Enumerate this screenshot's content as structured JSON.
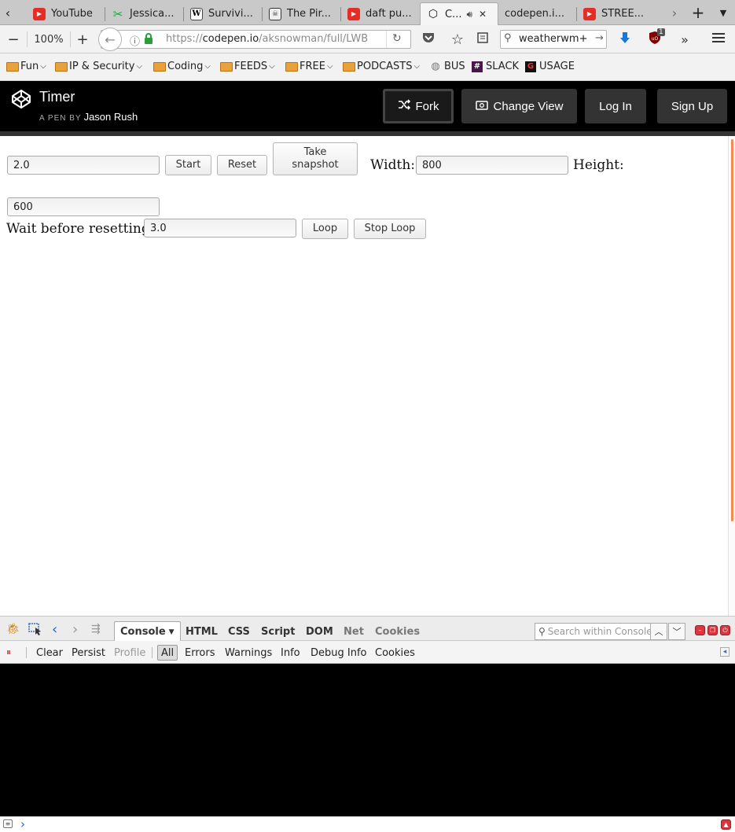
{
  "browser": {
    "tabs": [
      {
        "label": "YouTube",
        "icon": "youtube-icon"
      },
      {
        "label": "Jessica...",
        "icon": "green-logo-icon"
      },
      {
        "label": "Survivi...",
        "icon": "wikipedia-icon"
      },
      {
        "label": "The Pir...",
        "icon": "pirate-icon"
      },
      {
        "label": "daft pu...",
        "icon": "youtube-icon"
      },
      {
        "label": "C...",
        "icon": "codepen-icon",
        "active": true
      },
      {
        "label": "codepen.i...",
        "icon": ""
      },
      {
        "label": "STREE...",
        "icon": "youtube-icon"
      }
    ],
    "zoom": "100%",
    "url_prefix": "https://",
    "url_host": "codepen.io",
    "url_path": "/aksnowman/full/LWB",
    "search_value": "weatherwm+",
    "ublock_badge": "1",
    "bookmarks": [
      {
        "label": "Fun",
        "type": "folder"
      },
      {
        "label": "IP & Security",
        "type": "folder"
      },
      {
        "label": "Coding",
        "type": "folder"
      },
      {
        "label": "FEEDS",
        "type": "folder"
      },
      {
        "label": "FREE",
        "type": "folder"
      },
      {
        "label": "PODCASTS",
        "type": "folder"
      },
      {
        "label": "BUS",
        "type": "link"
      },
      {
        "label": "SLACK",
        "type": "link"
      },
      {
        "label": "USAGE",
        "type": "link"
      }
    ]
  },
  "codepen": {
    "title": "Timer",
    "byline": "A PEN BY",
    "author": "Jason Rush",
    "fork": "Fork",
    "change_view": "Change View",
    "login": "Log In",
    "signup": "Sign Up"
  },
  "app": {
    "duration_value": "2.0",
    "start": "Start",
    "reset": "Reset",
    "snapshot": "Take snapshot",
    "width_label": "Width:",
    "width_value": "800",
    "height_label": "Height:",
    "height_value": "600",
    "wait_label": "Wait before resetting",
    "wait_value": "3.0",
    "loop": "Loop",
    "stop_loop": "Stop Loop"
  },
  "firebug": {
    "tabs": [
      "Console",
      "HTML",
      "CSS",
      "Script",
      "DOM",
      "Net",
      "Cookies"
    ],
    "search_placeholder": "Search within Console",
    "console_buttons": [
      "Clear",
      "Persist",
      "Profile",
      "All",
      "Errors",
      "Warnings",
      "Info",
      "Debug Info",
      "Cookies"
    ],
    "prompt": "›"
  }
}
